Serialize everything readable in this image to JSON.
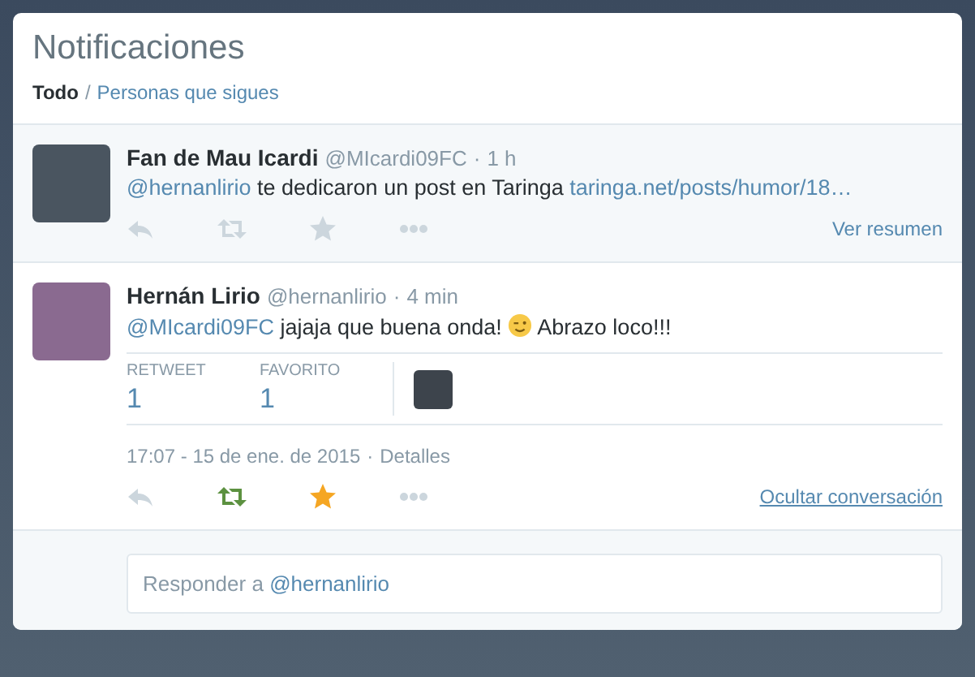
{
  "header": {
    "title": "Notificaciones",
    "separator": "/",
    "filters": [
      {
        "label": "Todo",
        "selected": true
      },
      {
        "label": "Personas que sigues",
        "selected": false
      }
    ]
  },
  "tweets": [
    {
      "name": "Fan de Mau Icardi",
      "handle": "@MIcardi09FC",
      "dot": "·",
      "time": "1 h",
      "content": [
        {
          "kind": "mention",
          "text": "@hernanlirio"
        },
        {
          "kind": "text",
          "text": "te dedicaron un post en Taringa"
        },
        {
          "kind": "link",
          "text": "taringa.net/posts/humor/18…"
        }
      ],
      "expanded": false,
      "summary_link": "Ver resumen",
      "retweeted": false,
      "favorited": false
    },
    {
      "name": "Hernán Lirio",
      "handle": "@hernanlirio",
      "dot": "·",
      "time": "4 min",
      "content": [
        {
          "kind": "mention",
          "text": "@MIcardi09FC"
        },
        {
          "kind": "text",
          "text": "jajaja que buena onda!"
        },
        {
          "kind": "emoji"
        },
        {
          "kind": "text",
          "text": "Abrazo loco!!!"
        }
      ],
      "expanded": true,
      "stats": [
        {
          "label": "RETWEET",
          "value": "1"
        },
        {
          "label": "FAVORITO",
          "value": "1"
        }
      ],
      "timestamp": "17:07 - 15 de ene. de 2015",
      "details_dot": "·",
      "details": "Detalles",
      "summary_link": "Ocultar conversación",
      "retweeted": true,
      "favorited": true
    }
  ],
  "reply": {
    "placeholder": "Responder a",
    "mention": "@hernanlirio"
  }
}
